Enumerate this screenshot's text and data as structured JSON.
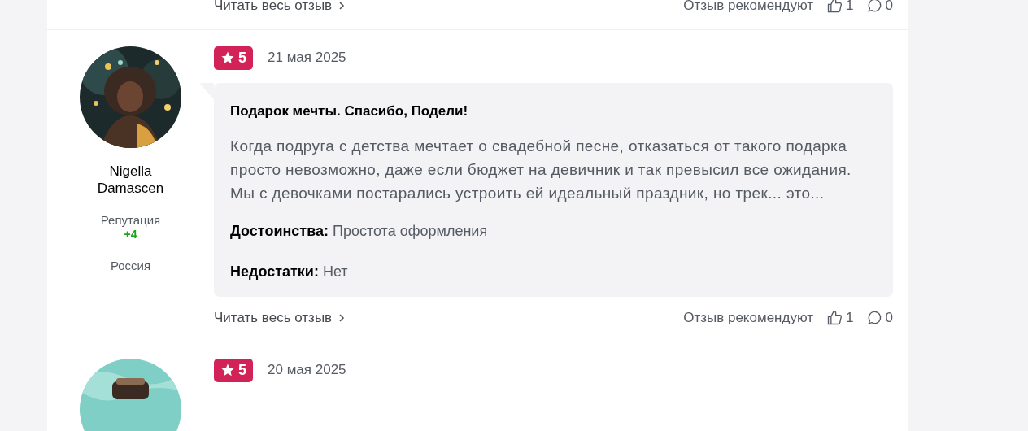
{
  "reviews": [
    {
      "footer": {
        "read_more": "Читать весь отзыв",
        "recommend_label": "Отзыв рекомендуют",
        "likes": "1",
        "comments": "0"
      }
    },
    {
      "author": {
        "name": "Nigella Damascen",
        "reputation_label": "Репутация",
        "reputation": "+4",
        "country": "Россия"
      },
      "rating": "5",
      "date": "21 мая 2025",
      "title": "Подарок мечты. Спасибо, Подели!",
      "text": "Когда подруга с детства мечтает о свадебной песне, отказаться от такого подарка просто невозможно, даже если бюджет на девичник и так превысил все ожидания. Мы с девочками постарались устроить ей идеальный праздник, но трек... это...",
      "pros_label": "Достоинства:",
      "pros": "Простота оформления",
      "cons_label": "Недостатки:",
      "cons": "Нет",
      "footer": {
        "read_more": "Читать весь отзыв",
        "recommend_label": "Отзыв рекомендуют",
        "likes": "1",
        "comments": "0"
      }
    },
    {
      "rating": "5",
      "date": "20 мая 2025"
    }
  ]
}
